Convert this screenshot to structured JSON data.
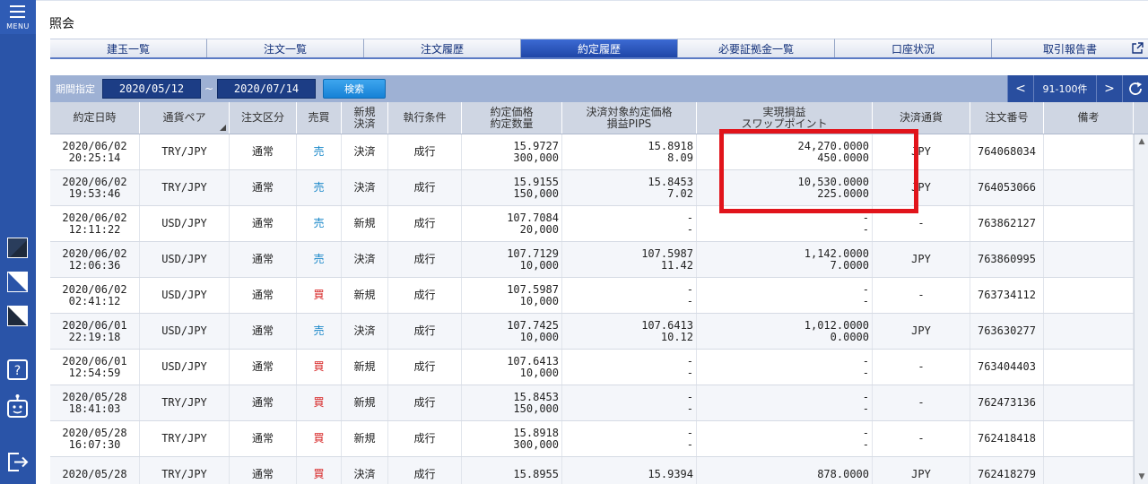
{
  "sidebar": {
    "menu_label": "MENU",
    "theme_colors": [
      "#1e2a3c",
      "#ffffff",
      "#2a54a8"
    ],
    "icons": [
      "help-icon",
      "robot-icon",
      "logout-icon"
    ]
  },
  "header": {
    "title": "照会"
  },
  "tabs": [
    {
      "label": "建玉一覧"
    },
    {
      "label": "注文一覧"
    },
    {
      "label": "注文履歴"
    },
    {
      "label": "約定履歴",
      "active": true
    },
    {
      "label": "必要証拠金一覧"
    },
    {
      "label": "口座状況"
    },
    {
      "label": "取引報告書"
    }
  ],
  "filter": {
    "label": "期間指定",
    "date_from": "2020/05/12",
    "separator": "~",
    "date_to": "2020/07/14",
    "search_label": "検索",
    "pager_prev": "<",
    "pager_range": "91-100件",
    "pager_next": ">",
    "refresh_icon": "refresh-icon"
  },
  "table": {
    "headers": [
      "約定日時",
      "通貨ペア",
      "注文区分",
      "売買",
      "新規\n決済",
      "執行条件",
      "約定価格\n約定数量",
      "決済対象約定価格\n損益PIPS",
      "実現損益\nスワップポイント",
      "決済通貨",
      "注文番号",
      "備考"
    ],
    "rows": [
      {
        "date": "2020/06/02",
        "time": "20:25:14",
        "pair": "TRY/JPY",
        "order_type": "通常",
        "side": "売",
        "side_kind": "sell",
        "open_close": "決済",
        "exec": "成行",
        "price": "15.9727",
        "qty": "300,000",
        "target_price": "15.8918",
        "pips": "8.09",
        "pnl": "24,270.0000",
        "swap": "450.0000",
        "currency": "JPY",
        "order_no": "764068034",
        "note": ""
      },
      {
        "date": "2020/06/02",
        "time": "19:53:46",
        "pair": "TRY/JPY",
        "order_type": "通常",
        "side": "売",
        "side_kind": "sell",
        "open_close": "決済",
        "exec": "成行",
        "price": "15.9155",
        "qty": "150,000",
        "target_price": "15.8453",
        "pips": "7.02",
        "pnl": "10,530.0000",
        "swap": "225.0000",
        "currency": "JPY",
        "order_no": "764053066",
        "note": ""
      },
      {
        "date": "2020/06/02",
        "time": "12:11:22",
        "pair": "USD/JPY",
        "order_type": "通常",
        "side": "売",
        "side_kind": "sell",
        "open_close": "新規",
        "exec": "成行",
        "price": "107.7084",
        "qty": "20,000",
        "target_price": "-",
        "pips": "-",
        "pnl": "-",
        "swap": "-",
        "currency": "-",
        "order_no": "763862127",
        "note": ""
      },
      {
        "date": "2020/06/02",
        "time": "12:06:36",
        "pair": "USD/JPY",
        "order_type": "通常",
        "side": "売",
        "side_kind": "sell",
        "open_close": "決済",
        "exec": "成行",
        "price": "107.7129",
        "qty": "10,000",
        "target_price": "107.5987",
        "pips": "11.42",
        "pnl": "1,142.0000",
        "swap": "7.0000",
        "currency": "JPY",
        "order_no": "763860995",
        "note": ""
      },
      {
        "date": "2020/06/02",
        "time": "02:41:12",
        "pair": "USD/JPY",
        "order_type": "通常",
        "side": "買",
        "side_kind": "buy",
        "open_close": "新規",
        "exec": "成行",
        "price": "107.5987",
        "qty": "10,000",
        "target_price": "-",
        "pips": "-",
        "pnl": "-",
        "swap": "-",
        "currency": "-",
        "order_no": "763734112",
        "note": ""
      },
      {
        "date": "2020/06/01",
        "time": "22:19:18",
        "pair": "USD/JPY",
        "order_type": "通常",
        "side": "売",
        "side_kind": "sell",
        "open_close": "決済",
        "exec": "成行",
        "price": "107.7425",
        "qty": "10,000",
        "target_price": "107.6413",
        "pips": "10.12",
        "pnl": "1,012.0000",
        "swap": "0.0000",
        "currency": "JPY",
        "order_no": "763630277",
        "note": ""
      },
      {
        "date": "2020/06/01",
        "time": "12:54:59",
        "pair": "USD/JPY",
        "order_type": "通常",
        "side": "買",
        "side_kind": "buy",
        "open_close": "新規",
        "exec": "成行",
        "price": "107.6413",
        "qty": "10,000",
        "target_price": "-",
        "pips": "-",
        "pnl": "-",
        "swap": "-",
        "currency": "-",
        "order_no": "763404403",
        "note": ""
      },
      {
        "date": "2020/05/28",
        "time": "18:41:03",
        "pair": "TRY/JPY",
        "order_type": "通常",
        "side": "買",
        "side_kind": "buy",
        "open_close": "新規",
        "exec": "成行",
        "price": "15.8453",
        "qty": "150,000",
        "target_price": "-",
        "pips": "-",
        "pnl": "-",
        "swap": "-",
        "currency": "-",
        "order_no": "762473136",
        "note": ""
      },
      {
        "date": "2020/05/28",
        "time": "16:07:30",
        "pair": "TRY/JPY",
        "order_type": "通常",
        "side": "買",
        "side_kind": "buy",
        "open_close": "新規",
        "exec": "成行",
        "price": "15.8918",
        "qty": "300,000",
        "target_price": "-",
        "pips": "-",
        "pnl": "-",
        "swap": "-",
        "currency": "-",
        "order_no": "762418418",
        "note": ""
      },
      {
        "date": "2020/05/28",
        "time": "",
        "pair": "TRY/JPY",
        "order_type": "通常",
        "side": "買",
        "side_kind": "buy",
        "open_close": "決済",
        "exec": "成行",
        "price": "15.8955",
        "qty": "",
        "target_price": "15.9394",
        "pips": "",
        "pnl": "878.0000",
        "swap": "",
        "currency": "JPY",
        "order_no": "762418279",
        "note": ""
      }
    ]
  },
  "colors": {
    "accent": "#2a54a8",
    "sell": "#1a88c9",
    "buy": "#d62020",
    "highlight": "#e1141b"
  }
}
